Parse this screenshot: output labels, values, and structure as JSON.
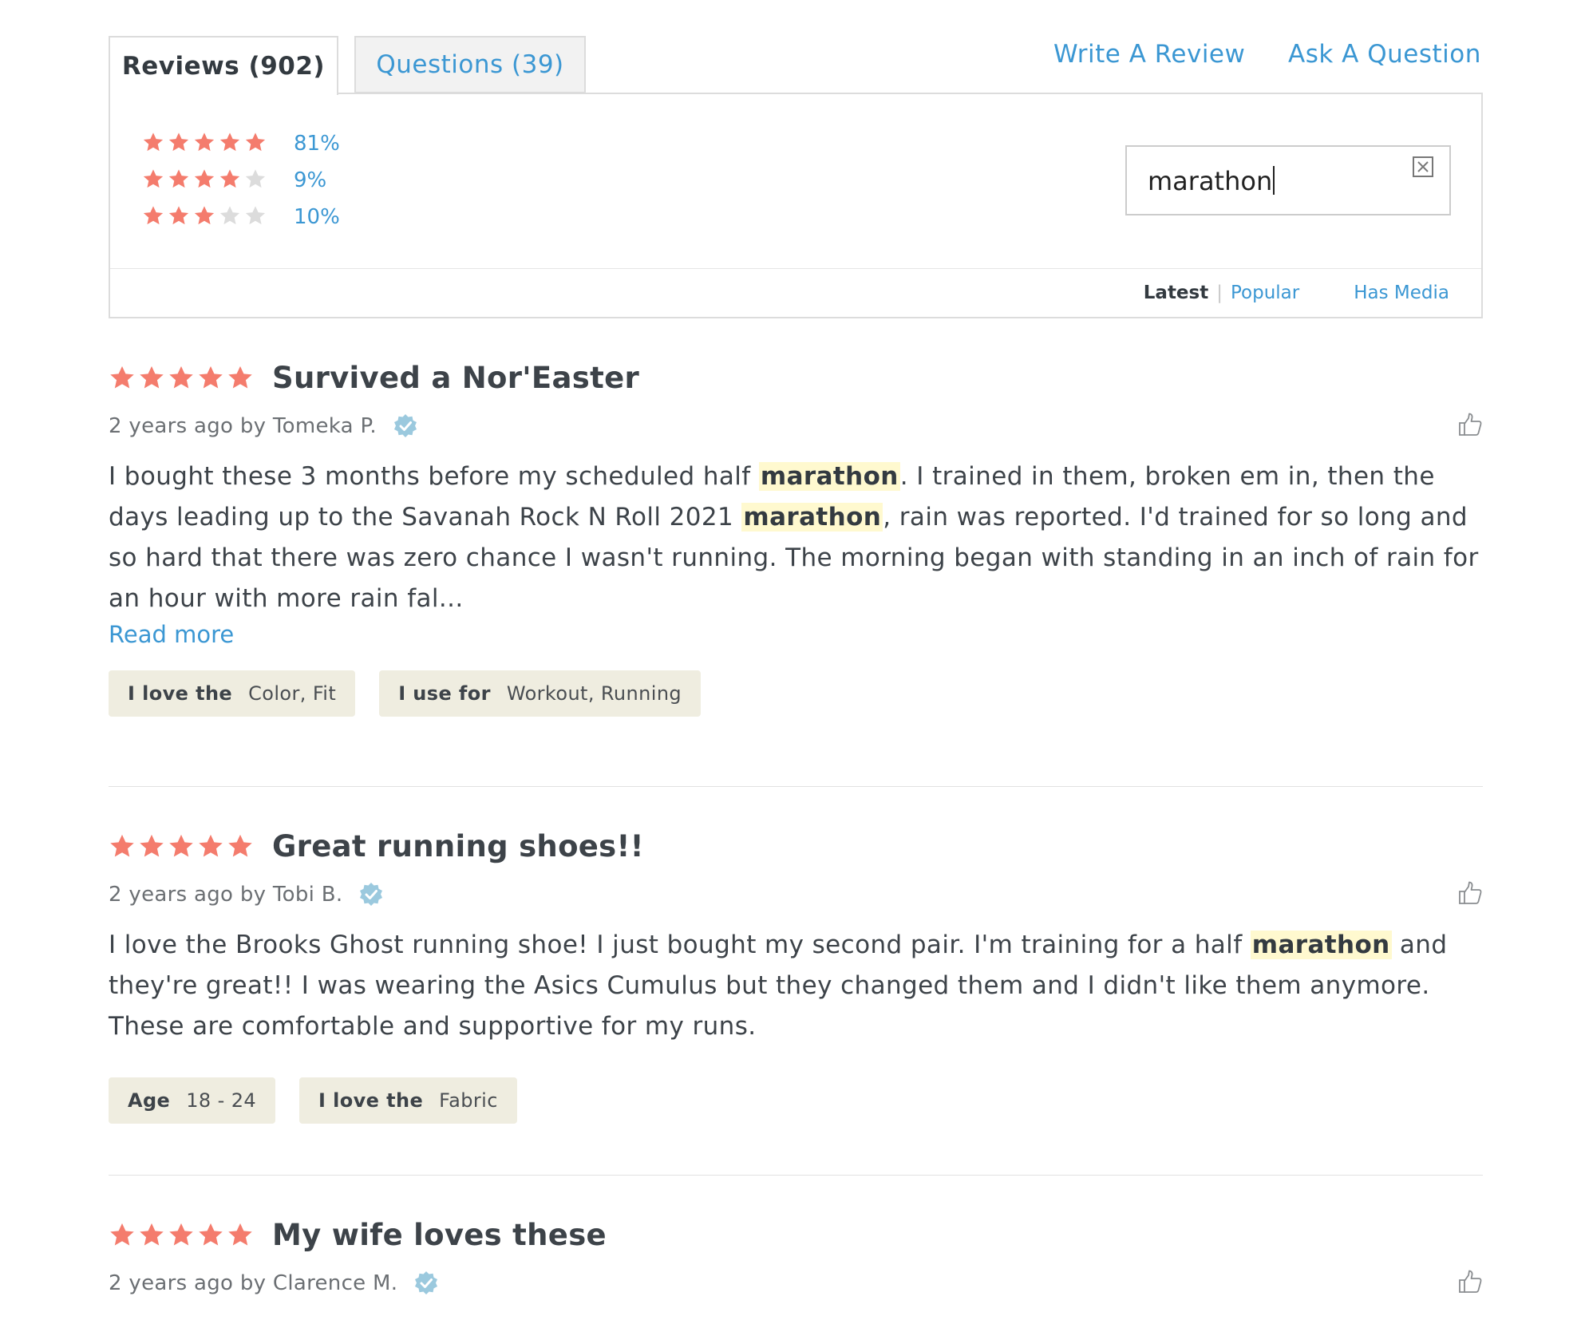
{
  "colors": {
    "star": "#f47c6d",
    "star_empty": "#dcdcdc",
    "link": "#3b97d3",
    "highlight": "#fff9cf",
    "tag_bg": "#efede0",
    "verified": "#9bc9de"
  },
  "tabs": [
    {
      "label": "Reviews (902)",
      "active": true
    },
    {
      "label": "Questions (39)",
      "active": false
    }
  ],
  "actions": {
    "write_review": "Write A Review",
    "ask_question": "Ask A Question"
  },
  "rating_distribution": [
    {
      "stars": 5,
      "percent": "81%"
    },
    {
      "stars": 4,
      "percent": "9%"
    },
    {
      "stars": 3,
      "percent": "10%"
    }
  ],
  "search": {
    "value": "marathon",
    "clear_icon": "close-box-icon"
  },
  "sort": {
    "latest": "Latest",
    "separator": "|",
    "popular": "Popular",
    "has_media": "Has Media"
  },
  "reviews": [
    {
      "rating": 5,
      "title": "Survived a Nor'Easter",
      "meta": "2 years ago by Tomeka P.",
      "verified": true,
      "body": [
        {
          "text": "I bought these 3 months before my scheduled half "
        },
        {
          "text": "marathon",
          "hl": true
        },
        {
          "text": ". I trained in them, broken em in, then the days leading up to the Savanah Rock N Roll 2021 "
        },
        {
          "text": "marathon",
          "hl": true
        },
        {
          "text": ", rain was reported. I'd trained for so long and so hard that there was zero chance I wasn't running. The morning began with standing in an inch of rain for an hour with more rain fal..."
        }
      ],
      "read_more": "Read more",
      "tags": [
        {
          "label": "I love the",
          "value": "Color, Fit"
        },
        {
          "label": "I use for",
          "value": "Workout, Running"
        }
      ]
    },
    {
      "rating": 5,
      "title": "Great running shoes!!",
      "meta": "2 years ago by Tobi B.",
      "verified": true,
      "body": [
        {
          "text": "I love the Brooks Ghost running shoe! I just bought my second pair. I'm training for a half "
        },
        {
          "text": "marathon",
          "hl": true
        },
        {
          "text": " and they're great!! I was wearing the Asics Cumulus but they changed them and I didn't like them anymore. These are comfortable and supportive for my runs."
        }
      ],
      "tags": [
        {
          "label": "Age",
          "value": "18 - 24"
        },
        {
          "label": "I love the",
          "value": "Fabric"
        }
      ]
    },
    {
      "rating": 5,
      "title": "My wife loves these",
      "meta": "2 years ago by Clarence M.",
      "verified": true
    }
  ]
}
